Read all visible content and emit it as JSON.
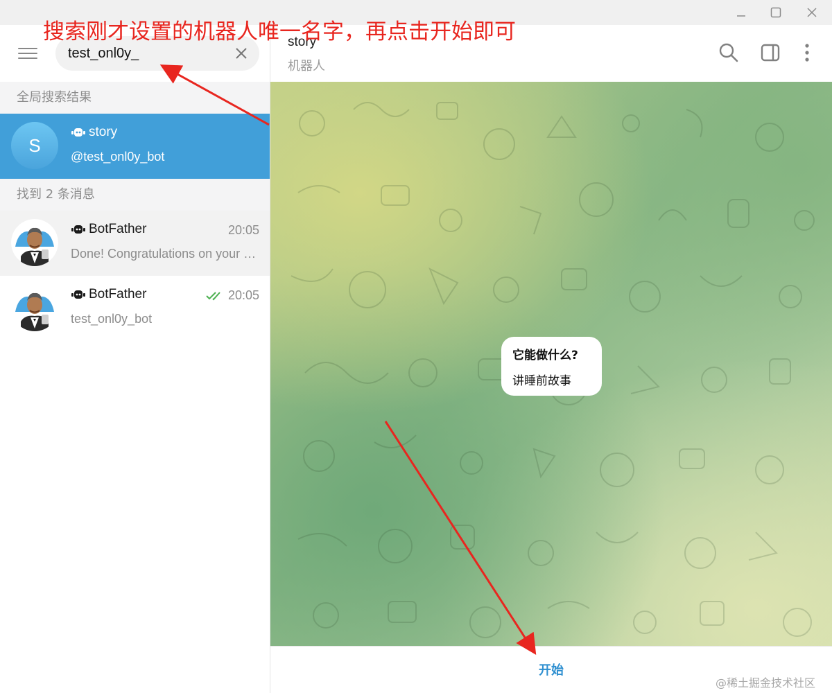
{
  "window": {
    "controls": [
      "minimize",
      "maximize",
      "close"
    ]
  },
  "annotation": {
    "text": "搜索刚才设置的机器人唯一名字，再点击开始即可",
    "color": "#e8261f"
  },
  "sidebar": {
    "search": {
      "value": "test_onl0y_"
    },
    "global_results_header": "全局搜索结果",
    "global_results": [
      {
        "avatar_letter": "S",
        "title": "story",
        "subtitle": "@test_onl0y_bot",
        "bot_icon": "bot-icon"
      }
    ],
    "found_messages_header": "找到 2 条消息",
    "messages": [
      {
        "title": "BotFather",
        "time": "20:05",
        "preview": "Done! Congratulations on your new bot.",
        "bot_icon": "bot-icon"
      },
      {
        "title": "BotFather",
        "time": "20:05",
        "preview": "test_onl0y_bot",
        "bot_icon": "bot-icon",
        "status_icon": "double-check-icon"
      }
    ]
  },
  "chat": {
    "title": "story",
    "status": "机器人",
    "header_icons": [
      "search-icon",
      "sidebar-toggle-icon",
      "more-vertical-icon"
    ],
    "bot_info": {
      "title": "它能做什么?",
      "description": "讲睡前故事"
    },
    "start_label": "开始"
  },
  "watermark": "@稀土掘金技术社区",
  "colors": {
    "accent": "#419fd9",
    "start_text": "#2e8fd0",
    "check": "#4cb050"
  }
}
